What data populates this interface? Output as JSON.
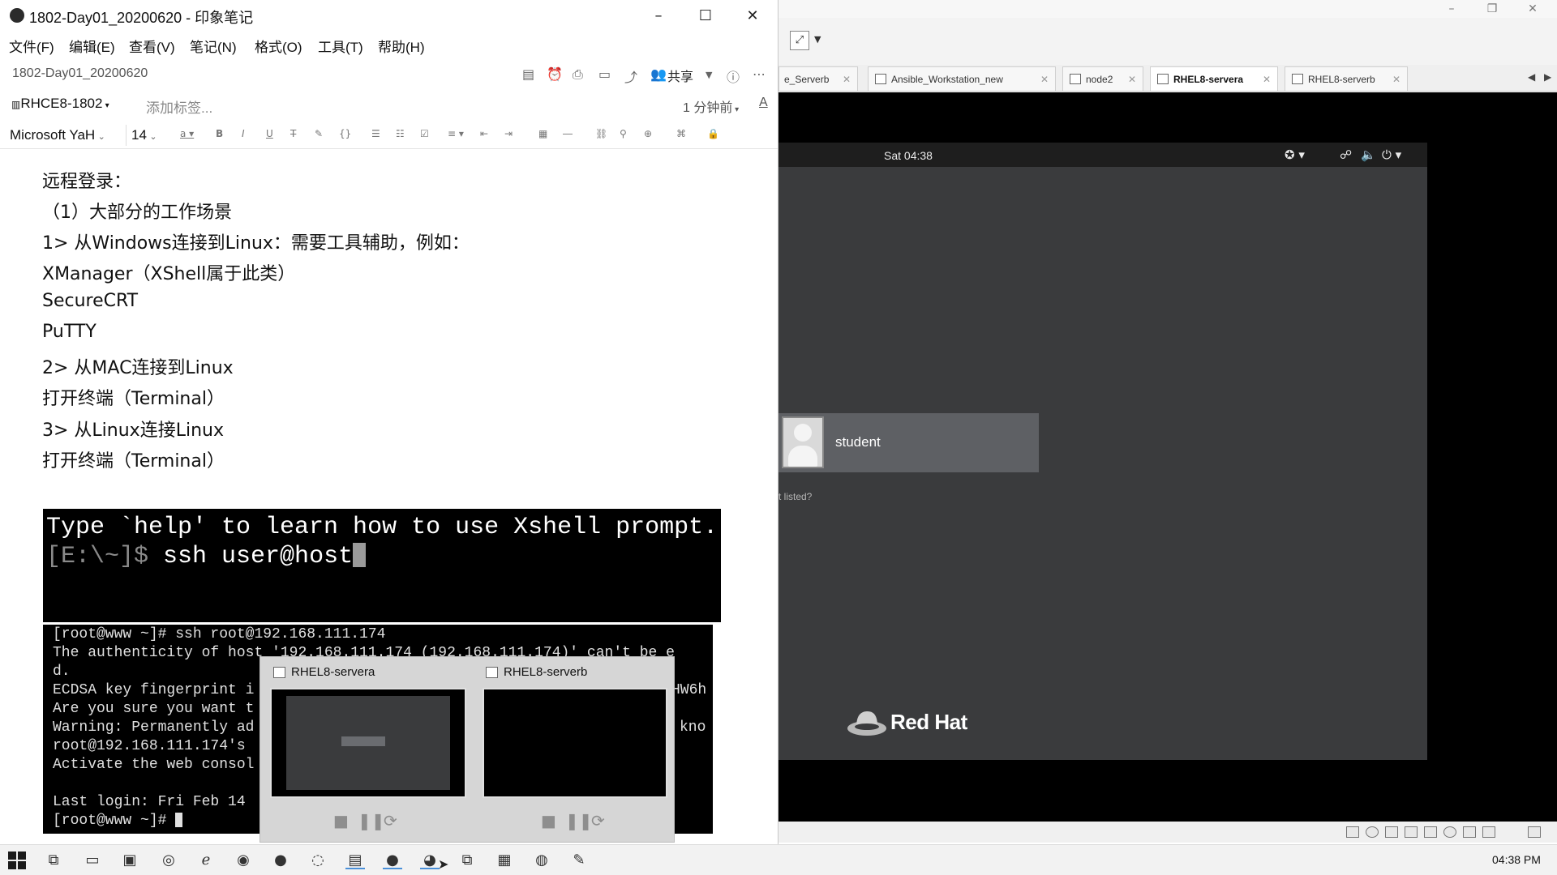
{
  "vmware": {
    "toolbar": {
      "fullscreen_icon": "fullscreen-icon",
      "dropdown_icon": "chevron-down-icon"
    },
    "tabs": [
      {
        "label": "e_Serverb"
      },
      {
        "label": "Ansible_Workstation_new"
      },
      {
        "label": "node2"
      },
      {
        "label": "RHEL8-servera",
        "active": true
      },
      {
        "label": "RHEL8-serverb"
      }
    ],
    "guest": {
      "clock": "Sat 04:38",
      "user_name": "student",
      "not_listed_text": "t listed?",
      "brand": "Red Hat"
    }
  },
  "evernote": {
    "window_title": "1802-Day01_20200620 - 印象笔记",
    "menu": [
      "文件(F)",
      "编辑(E)",
      "查看(V)",
      "笔记(N)",
      "格式(O)",
      "工具(T)",
      "帮助(H)"
    ],
    "note_breadcrumb": "1802-Day01_20200620",
    "share_label": "共享",
    "notebook": "RHCE8-1802",
    "add_tag_placeholder": "添加标签...",
    "edit_time": "1 分钟前",
    "font": "Microsoft YaH",
    "font_size": "14",
    "body_lines": [
      "远程登录：",
      "（1）大部分的工作场景",
      "1> 从Windows连接到Linux：需要工具辅助，例如：",
      "XManager（XShell属于此类）",
      "SecureCRT",
      "PuTTY",
      "2> 从MAC连接到Linux",
      "打开终端（Terminal）",
      "3> 从Linux连接Linux",
      "打开终端（Terminal）"
    ],
    "xshell_image": {
      "line1": "Type `help' to learn how to use Xshell prompt.",
      "prompt": "[E:\\~]$",
      "command": " ssh user@host"
    },
    "ssh_image": {
      "lines": [
        "[root@www ~]# ssh root@192.168.111.174",
        "The authenticity of host '192.168.111.174 (192.168.111.174)' can't be e",
        "d.",
        "ECDSA key fingerprint i",
        "Are you sure you want t",
        "Warning: Permanently ad",
        "root@192.168.111.174's",
        "Activate the web consol",
        "",
        "Last login: Fri Feb 14",
        "[root@www ~]# "
      ],
      "right_fragments": [
        "HW6h",
        "kno"
      ]
    }
  },
  "thumbnail_popup": {
    "items": [
      {
        "title": "RHEL8-servera"
      },
      {
        "title": "RHEL8-serverb"
      }
    ]
  },
  "taskbar": {
    "clock": "04:38 PM"
  }
}
